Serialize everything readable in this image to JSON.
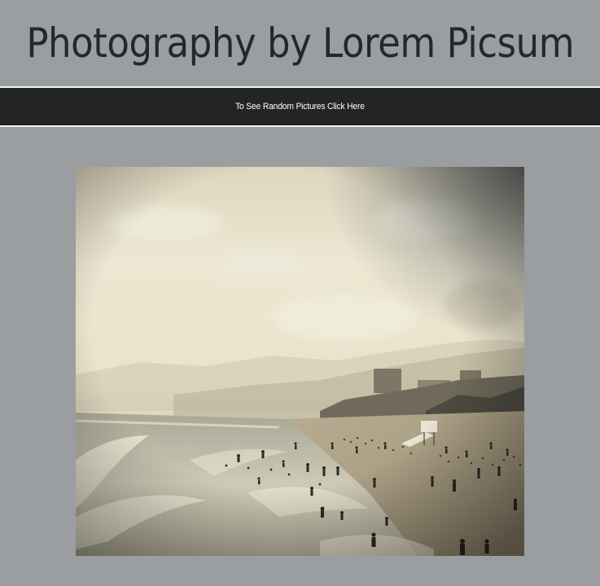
{
  "header": {
    "title": "Photography by Lorem Picsum"
  },
  "nav": {
    "link_label": "To See Random Pictures Click Here"
  },
  "photo": {
    "alt": "Sepia-toned beach scene with swimmers and a lifeguard tower"
  }
}
